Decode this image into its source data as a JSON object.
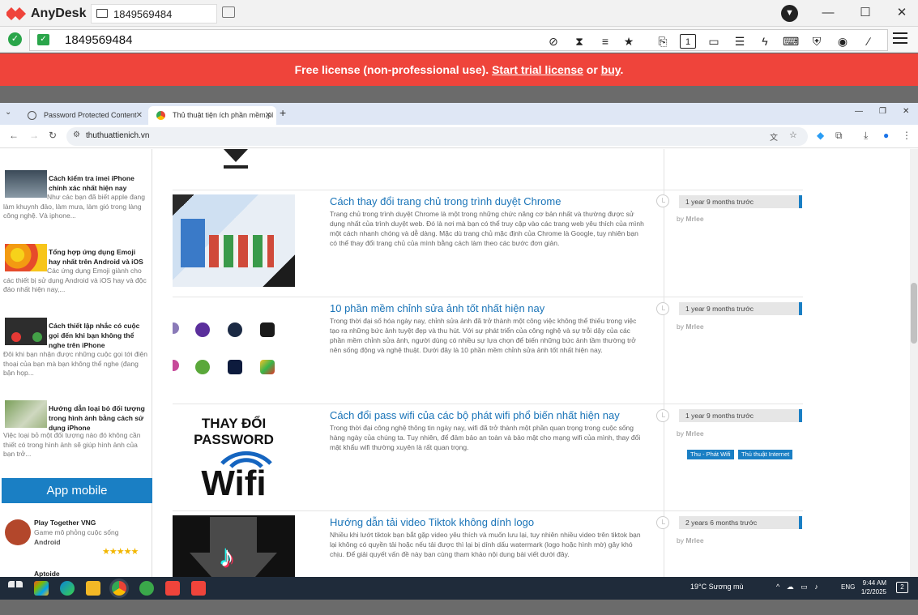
{
  "anydesk": {
    "app_name": "AnyDesk",
    "tab_id": "1849569484",
    "address_id": "1849569484",
    "license": {
      "text": "Free license (non-professional use).",
      "trial_link": "Start trial license",
      "or": "or",
      "buy_link": "buy",
      "period": "."
    },
    "toolbar_icons": [
      "privacy-icon",
      "hourglass-icon",
      "database-icon",
      "star-icon",
      "file-transfer-icon",
      "monitor-1-icon",
      "display-icon",
      "chat-icon",
      "lightning-icon",
      "keyboard-icon",
      "shield-icon",
      "record-icon",
      "pen-icon",
      "menu-icon"
    ],
    "colors": {
      "banner": "#ef443b",
      "accent": "#2aa54a"
    }
  },
  "chrome": {
    "tabs": [
      {
        "label": "Password Protected Content"
      },
      {
        "label": "Thủ thuật tiện ích phần mềm,pl"
      }
    ],
    "url": "thuthuattienich.vn"
  },
  "sidebar": {
    "items": [
      {
        "title": "Cách kiểm tra imei iPhone chính xác nhất hiện nay",
        "desc": "Như các bạn đã biết apple đang làm khuynh đảo, làm mưa, làm gió trong làng công nghệ. Và iphone..."
      },
      {
        "title": "Tổng hợp ứng dụng Emoji hay nhất trên Android và iOS",
        "desc": "Các ứng dụng Emoji giành cho các thiết bị sử dụng Android và iOS hay và độc đáo nhất hiện nay,..."
      },
      {
        "title": "Cách thiết lập nhắc có cuộc gọi đến khi bạn không thể nghe trên iPhone",
        "desc": "Đôi khi bạn nhận được những cuộc gọi tới điện thoại của bạn mà bạn không thể nghe (đang bận họp..."
      },
      {
        "title": "Hướng dẫn loại bỏ đối tượng trong hình ảnh bằng cách sử dụng iPhone",
        "desc": "Việc loại bỏ một đối tượng nào đó không cần thiết có trong hình ảnh sẽ giúp hình ảnh của bạn trở..."
      }
    ],
    "app_mobile_heading": "App mobile",
    "apps": [
      {
        "title": "Play Together VNG",
        "desc": "Game mô phỏng cuộc sống",
        "platform": "Android",
        "rating": 5
      },
      {
        "title": "Aptoide"
      }
    ]
  },
  "articles": [
    {
      "title": "Cách thay đổi trang chủ trong trình duyệt Chrome",
      "desc": "Trang chủ trong trình duyệt Chrome là một trong những chức năng cơ bản nhất và thường được sử dụng nhất của trình duyệt web. Đó là nơi mà bạn có thể truy cập vào các trang web yêu thích của mình một cách nhanh chóng và dễ dàng. Mặc dù trang chủ mặc định của Chrome là Google, tuy nhiên bạn có thể thay đổi trang chủ của mình bằng cách làm theo các bước đơn giản.",
      "date": "1 year 9 months trước",
      "by": "by",
      "author": "Mrlee",
      "tags": []
    },
    {
      "title": "10 phần mềm chỉnh sửa ảnh tốt nhất hiện nay",
      "desc": "Trong thời đại số hóa ngày nay, chỉnh sửa ảnh đã trở thành một công việc không thể thiếu trong việc tạo ra những bức ảnh tuyệt đẹp và thu hút. Với sự phát triển của công nghệ và sự trỗi dậy của các phần mềm chỉnh sửa ảnh, người dùng có nhiều sự lựa chọn để biến những bức ảnh tầm thường trở nên sống động và nghệ thuật. Dưới đây là 10 phần mềm chỉnh sửa ảnh tốt nhất hiện nay.",
      "date": "1 year 9 months trước",
      "by": "by",
      "author": "Mrlee",
      "tags": []
    },
    {
      "title": "Cách đổi pass wifi của các bộ phát wifi phổ biến nhất hiện nay",
      "desc": "Trong thời đại công nghệ thông tin ngày nay, wifi đã trở thành một phần quan trọng trong cuộc sống hàng ngày của chúng ta. Tuy nhiên, để đảm bảo an toàn và bảo mật cho mạng wifi của mình, thay đổi mật khẩu wifi thường xuyên là rất quan trọng.",
      "date": "1 year 9 months trước",
      "by": "by",
      "author": "Mrlee",
      "tags": [
        "Thu - Phát Wifi",
        "Thủ thuật Internet"
      ],
      "thumb_heading": "THAY ĐỔI PASSWORD",
      "thumb_word": "Wifi"
    },
    {
      "title": "Hướng dẫn tải video Tiktok không dính logo",
      "desc": "Nhiều khi lướt tiktok bạn bắt gặp video yêu thích và muốn lưu lại, tuy nhiên nhiều video trên tiktok bạn lại không có quyền tải hoặc nếu tải được thì lại bị dính dấu watermark (logo hoặc hình mờ) gây khó chịu. Để giải quyết vấn đề này bạn cùng tham khảo nội dung bài viết dưới đây.",
      "date": "2 years 6 months trước",
      "by": "by",
      "author": "Mrlee",
      "tags": []
    }
  ],
  "taskbar": {
    "weather": "19°C  Sương mù",
    "lang": "ENG",
    "time": "9:44 AM",
    "date": "1/2/2025",
    "notifications": "2"
  }
}
